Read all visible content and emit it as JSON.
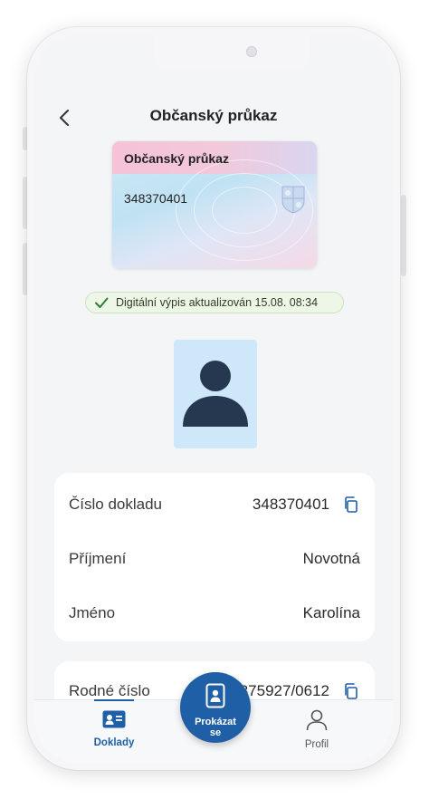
{
  "header": {
    "title": "Občanský průkaz",
    "back_icon": "chevron-left-icon"
  },
  "id_card": {
    "title": "Občanský průkaz",
    "number": "348370401"
  },
  "status": {
    "icon": "check-icon",
    "text": "Digitální výpis aktualizován 15.08. 08:34",
    "color": "#2e7d32"
  },
  "details": {
    "rows": [
      {
        "label": "Číslo dokladu",
        "value": "348370401",
        "copy": true
      },
      {
        "label": "Příjmení",
        "value": "Novotná",
        "copy": false
      },
      {
        "label": "Jméno",
        "value": "Karolína",
        "copy": false
      }
    ],
    "second_card": [
      {
        "label": "Rodné číslo",
        "value": "875927/0612",
        "copy": true
      }
    ]
  },
  "bottom_nav": {
    "items": [
      {
        "label": "Doklady",
        "icon": "id-card-icon",
        "active": true
      },
      {
        "label": "Profil",
        "icon": "user-icon",
        "active": false
      }
    ],
    "fab_label": "Prokázat se",
    "fab_icon": "phone-id-icon"
  },
  "colors": {
    "accent": "#1f5fa5",
    "photo_bg": "#cfe8f9",
    "avatar": "#263850"
  }
}
